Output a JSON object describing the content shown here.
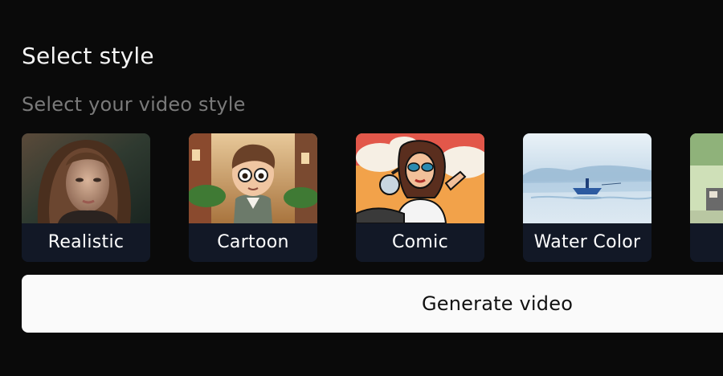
{
  "header": {
    "title": "Select style",
    "subtitle": "Select your video style"
  },
  "styles": [
    {
      "label": "Realistic",
      "image": "realistic-portrait-image"
    },
    {
      "label": "Cartoon",
      "image": "cartoon-boy-image"
    },
    {
      "label": "Comic",
      "image": "comic-motorcycle-woman-image"
    },
    {
      "label": "Water Color",
      "image": "watercolor-boat-image"
    },
    {
      "label": "",
      "image": "partial-style-image"
    }
  ],
  "actions": {
    "generate_label": "Generate video"
  },
  "colors": {
    "background": "#0a0a0a",
    "card_label_bg": "#121826",
    "button_bg": "#fafafa",
    "subtitle": "#7a7a7a"
  }
}
